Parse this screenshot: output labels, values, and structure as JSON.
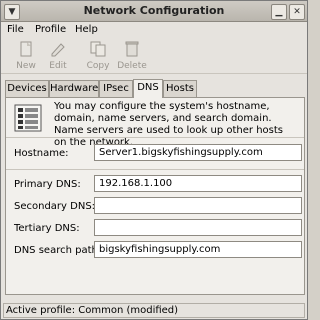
{
  "window": {
    "title": "Network Configuration"
  },
  "menu": {
    "file": "File",
    "profile": "Profile",
    "help": "Help"
  },
  "toolbar": {
    "new": "New",
    "edit": "Edit",
    "copy": "Copy",
    "delete": "Delete"
  },
  "tabs": [
    "Devices",
    "Hardware",
    "IPsec",
    "DNS",
    "Hosts"
  ],
  "active_tab": "DNS",
  "dns": {
    "description": "You may configure the system's hostname, domain, name servers, and search domain. Name servers are used to look up other hosts on the network.",
    "hostname_label": "Hostname:",
    "hostname_value": "Server1.bigskyfishingsupply.com",
    "primary_label": "Primary DNS:",
    "primary_value": "192.168.1.100",
    "secondary_label": "Secondary DNS:",
    "secondary_value": "",
    "tertiary_label": "Tertiary DNS:",
    "tertiary_value": "",
    "search_label": "DNS search path:",
    "search_value": "bigskyfishingsupply.com"
  },
  "status": {
    "text": "Active profile: Common (modified)"
  },
  "icons": [
    "window-menu-icon",
    "minimize-icon",
    "close-icon",
    "new-icon",
    "edit-icon",
    "copy-icon",
    "delete-icon",
    "dns-info-icon"
  ]
}
